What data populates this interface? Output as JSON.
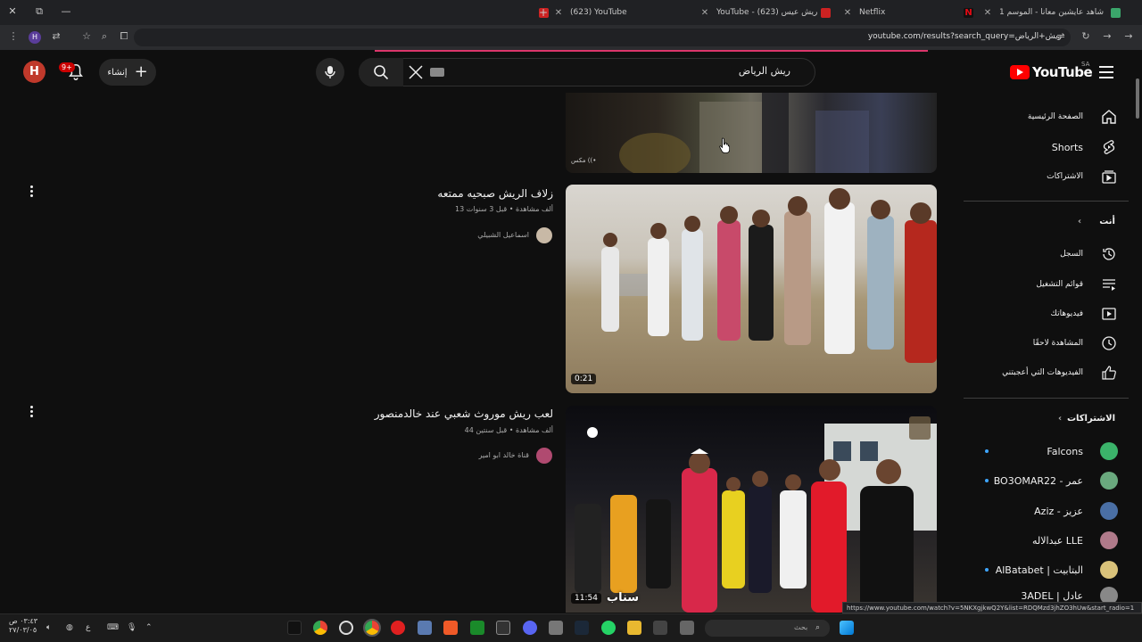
{
  "browser": {
    "tabs": [
      {
        "title": "شاهد عايشين معانا - الموسم 1",
        "icon": "shahid-icon"
      },
      {
        "title": "Netflix",
        "icon": "netflix-icon"
      },
      {
        "title": "YouTube - ريش عيس (623)",
        "icon": "youtube-icon"
      },
      {
        "title": "(623) YouTube",
        "icon": "youtube-icon"
      }
    ],
    "url": "youtube.com/results?search_query=ريش+الرياض",
    "status_url": "https://www.youtube.com/watch?v=5NKXgjkwQ2Y&list=RDQMzd3jhZO3hUw&start_radio=1"
  },
  "header": {
    "logo_text": "YouTube",
    "region": "SA",
    "search_query": "ريش الرياض",
    "create_label": "إنشاء",
    "notification_count": "9+",
    "avatar_letter": "H"
  },
  "sidebar": {
    "main": [
      {
        "label": "الصفحة الرئيسية",
        "icon": "home-icon"
      },
      {
        "label": "Shorts",
        "icon": "shorts-icon"
      },
      {
        "label": "الاشتراكات",
        "icon": "subscriptions-icon"
      }
    ],
    "you_header": "أنت",
    "you": [
      {
        "label": "السجل",
        "icon": "history-icon"
      },
      {
        "label": "قوائم التشغيل",
        "icon": "playlists-icon"
      },
      {
        "label": "فيديوهاتك",
        "icon": "your-videos-icon"
      },
      {
        "label": "المشاهدة لاحقًا",
        "icon": "watch-later-icon"
      },
      {
        "label": "الفيديوهات التي أعجبتني",
        "icon": "liked-icon"
      }
    ],
    "subs_header": "الاشتراكات",
    "subscriptions": [
      {
        "label": "Falcons",
        "color": "#3bb36a",
        "dot": true
      },
      {
        "label": "BO3OMAR22 - عمر",
        "color": "#6aa97e",
        "dot": true
      },
      {
        "label": "Aziz - عزيز",
        "color": "#4a6fa5",
        "dot": false
      },
      {
        "label": "عبدالاله LLE",
        "color": "#b07a8a",
        "dot": false
      },
      {
        "label": "AlBatabet | البتابيت",
        "color": "#d9c27a",
        "dot": true
      },
      {
        "label": "3ADEL | عادل",
        "color": "#888888",
        "dot": false
      }
    ]
  },
  "results": [
    {
      "title": "",
      "partial": true,
      "overlay_text": "مكس ((•"
    },
    {
      "title": "زلاف الريش صبحيه ممتعه",
      "views": "13 ألف مشاهدة",
      "age": "قبل 3 سنوات",
      "channel": "اسماعيل الشبيلي",
      "duration": "0:21"
    },
    {
      "title": "لعب ريش موروث شعبي عند خالدمنصور",
      "views": "44 ألف مشاهدة",
      "age": "قبل سنتين",
      "channel": "قناة خالد ابو امير",
      "duration": "11:54",
      "overlay_text": "سناب"
    }
  ],
  "taskbar": {
    "search_placeholder": "بحث",
    "clock_time": "٠٣:٤٣ ص",
    "clock_date": "٢٧/٠٣/٠٥",
    "lang": "ع"
  }
}
